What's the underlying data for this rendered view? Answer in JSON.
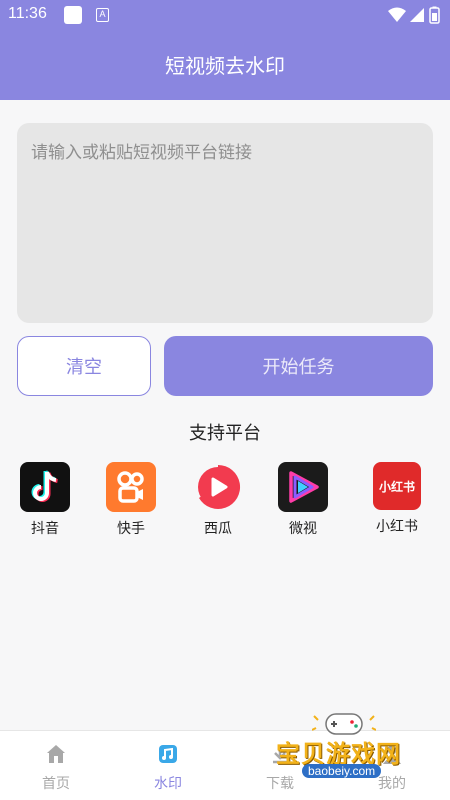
{
  "status_bar": {
    "time": "11:36",
    "a_badge": "A"
  },
  "app_bar": {
    "title": "短视频去水印"
  },
  "link_input": {
    "placeholder": "请输入或粘贴短视频平台链接",
    "value": ""
  },
  "buttons": {
    "clear": "清空",
    "start": "开始任务"
  },
  "platforms": {
    "title": "支持平台",
    "items": [
      {
        "name": "抖音",
        "icon": "douyin-icon",
        "color": "#111111"
      },
      {
        "name": "快手",
        "icon": "kuaishou-icon",
        "color": "#ff7a2e"
      },
      {
        "name": "西瓜",
        "icon": "xigua-icon",
        "color": "#f23b4f"
      },
      {
        "name": "微视",
        "icon": "weishi-icon",
        "color": "#1b1b1b"
      },
      {
        "name": "小红书",
        "icon": "xiaohongshu-icon",
        "color": "#e02a2a",
        "logo_text": "小红书"
      }
    ]
  },
  "tab_bar": {
    "tabs": [
      {
        "label": "首页",
        "icon": "home-icon",
        "active": false
      },
      {
        "label": "水印",
        "icon": "watermark-icon",
        "active": true
      },
      {
        "label": "下载",
        "icon": "download-icon",
        "active": false
      },
      {
        "label": "我的",
        "icon": "profile-icon",
        "active": false
      }
    ]
  },
  "overlay_watermark": {
    "text": "宝贝游戏网",
    "url": "baobeiy.com"
  },
  "colors": {
    "accent": "#8a86e0",
    "input_bg": "#e6e6e6",
    "inactive_tab": "#a8a8a8"
  }
}
